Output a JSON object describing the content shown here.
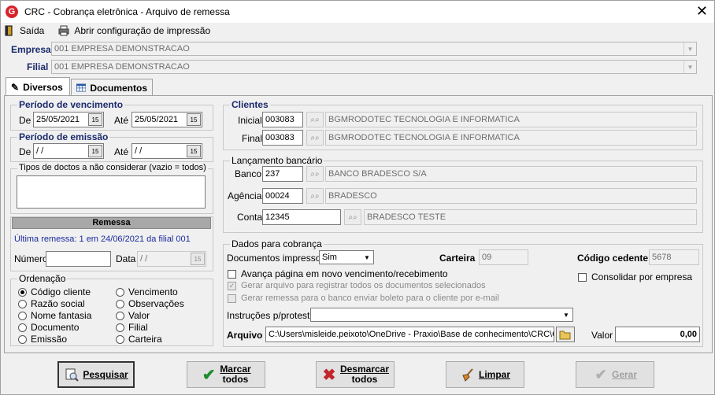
{
  "window": {
    "title": "CRC - Cobrança eletrônica - Arquivo de remessa",
    "close": "✕"
  },
  "menu": {
    "exit": "Saída",
    "print_config": "Abrir configuração de impressão"
  },
  "header": {
    "empresa_label": "Empresa",
    "empresa_value": "001 EMPRESA DEMONSTRACAO",
    "filial_label": "Filial",
    "filial_value": "001 EMPRESA DEMONSTRACAO"
  },
  "tabs": [
    {
      "label": "Diversos"
    },
    {
      "label": "Documentos"
    }
  ],
  "vencimento": {
    "title": "Período de vencimento",
    "de_label": "De",
    "de_value": "25/05/2021",
    "ate_label": "Até",
    "ate_value": "25/05/2021"
  },
  "emissao": {
    "title": "Período de emissão",
    "de_label": "De",
    "de_value": " / /",
    "ate_label": "Até",
    "ate_value": " / /"
  },
  "tipos": {
    "title": "Tipos de doctos a não considerar (vazio = todos)",
    "value": ""
  },
  "remessa": {
    "title": "Remessa",
    "info": "Última remessa: 1 em 24/06/2021 da filial 001",
    "numero_label": "Número",
    "numero_value": "",
    "data_label": "Data",
    "data_value": " / /"
  },
  "ordenacao": {
    "title": "Ordenação",
    "options": [
      "Código cliente",
      "Razão social",
      "Nome fantasia",
      "Documento",
      "Emissão",
      "Vencimento",
      "Observações",
      "Valor",
      "Filial",
      "Carteira"
    ],
    "selected": "Código cliente"
  },
  "clientes": {
    "title": "Clientes",
    "inicial_label": "Inicial",
    "inicial_code": "003083",
    "inicial_name": "BGMRODOTEC TECNOLOGIA  E INFORMATICA",
    "final_label": "Final",
    "final_code": "003083",
    "final_name": "BGMRODOTEC TECNOLOGIA  E INFORMATICA"
  },
  "lancamento": {
    "title": "Lançamento bancário",
    "banco_label": "Banco",
    "banco_code": "237",
    "banco_name": "BANCO BRADESCO S/A",
    "agencia_label": "Agência",
    "agencia_code": "00024",
    "agencia_name": "BRADESCO",
    "conta_label": "Conta",
    "conta_code": "12345",
    "conta_name": "BRADESCO TESTE"
  },
  "cobranca": {
    "title": "Dados para cobrança",
    "docs_label": "Documentos impressos",
    "docs_value": "Sim",
    "carteira_label": "Carteira",
    "carteira_value": "09",
    "cedente_label": "Código cedente",
    "cedente_value": "5678",
    "avanca": "Avança página em novo vencimento/recebimento",
    "gerar_todos": "Gerar arquivo para registrar todos os documentos selecionados",
    "gerar_email": "Gerar remessa para o banco enviar boleto para o cliente por e-mail",
    "consolidar": "Consolidar por empresa",
    "instrucoes_label": "Instruções p/protesto",
    "instrucoes_value": "",
    "arquivo_label": "Arquivo",
    "arquivo_value": "C:\\Users\\misleide.peixoto\\OneDrive - Praxio\\Base de conhecimento\\CRC\\C",
    "valor_label": "Valor",
    "valor_value": "0,00"
  },
  "buttons": {
    "pesquisar": "Pesquisar",
    "marcar1": "Marcar",
    "marcar2": "todos",
    "desmarcar1": "Desmarcar",
    "desmarcar2": "todos",
    "limpar": "Limpar",
    "gerar": "Gerar"
  },
  "colors": {
    "label_blue": "#1a2a6c",
    "logo_red": "#d8232a",
    "check_green": "#1e8c2a",
    "x_red": "#c0262a"
  }
}
